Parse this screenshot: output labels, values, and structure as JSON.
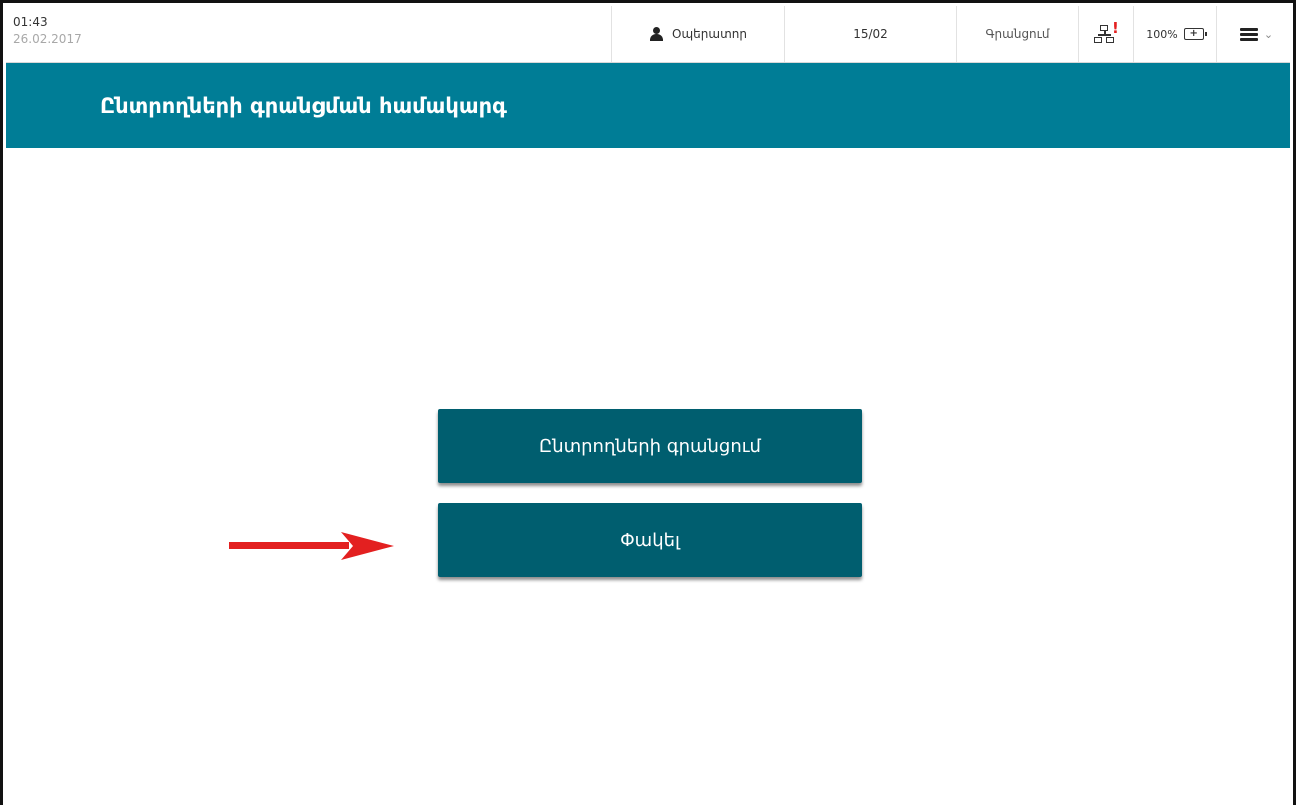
{
  "statusbar": {
    "time": "01:43",
    "date": "26.02.2017",
    "operator_label": "Օպերատոր",
    "counter": "15/02",
    "mode_label": "Գրանցում",
    "battery_percent": "100%",
    "network_warning": "!",
    "battery_icon_glyph": "+",
    "icons": {
      "operator": "user-icon",
      "network": "network-warning-icon",
      "battery": "battery-charging-icon",
      "menu": "hamburger-menu-icon",
      "dropdown": "chevron-down-icon"
    },
    "chevron_glyph": "⌄"
  },
  "header": {
    "title": "Ընտրողների գրանցման համակարգ",
    "background_color": "#007d96"
  },
  "main": {
    "register_button_label": "Ընտրողների գրանցում",
    "close_button_label": "Փակել",
    "button_color": "#005e6f",
    "annotation_arrow_color": "#e32020"
  }
}
